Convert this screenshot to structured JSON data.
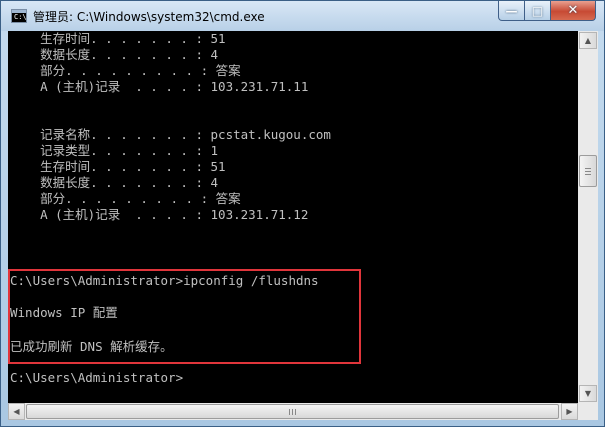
{
  "window": {
    "title": "管理员: C:\\Windows\\system32\\cmd.exe",
    "icon": "cmd-icon",
    "icon_text": "C:\\",
    "buttons": {
      "minimize": "—",
      "maximize": "□",
      "close": "✕"
    }
  },
  "console": {
    "lines": [
      "    生存时间. . . . . . . : 51",
      "    数据长度. . . . . . . : 4",
      "    部分. . . . . . . . . : 答案",
      "    A (主机)记录  . . . . : 103.231.71.11",
      "",
      "",
      "    记录名称. . . . . . . : pcstat.kugou.com",
      "    记录类型. . . . . . . : 1",
      "    生存时间. . . . . . . : 51",
      "    数据长度. . . . . . . : 4",
      "    部分. . . . . . . . . : 答案",
      "    A (主机)记录  . . . . : 103.231.71.12",
      "",
      "",
      "",
      "C:\\Users\\Administrator>ipconfig /flushdns",
      "",
      "Windows IP 配置",
      "",
      "已成功刷新 DNS 解析缓存。",
      "",
      "C:\\Users\\Administrator>"
    ],
    "highlight_color": "#e0353b",
    "text_color": "#c0c0c0",
    "background": "#000000"
  },
  "scrollbars": {
    "up_arrow": "▲",
    "down_arrow": "▼",
    "left_arrow": "◀",
    "right_arrow": "▶"
  }
}
